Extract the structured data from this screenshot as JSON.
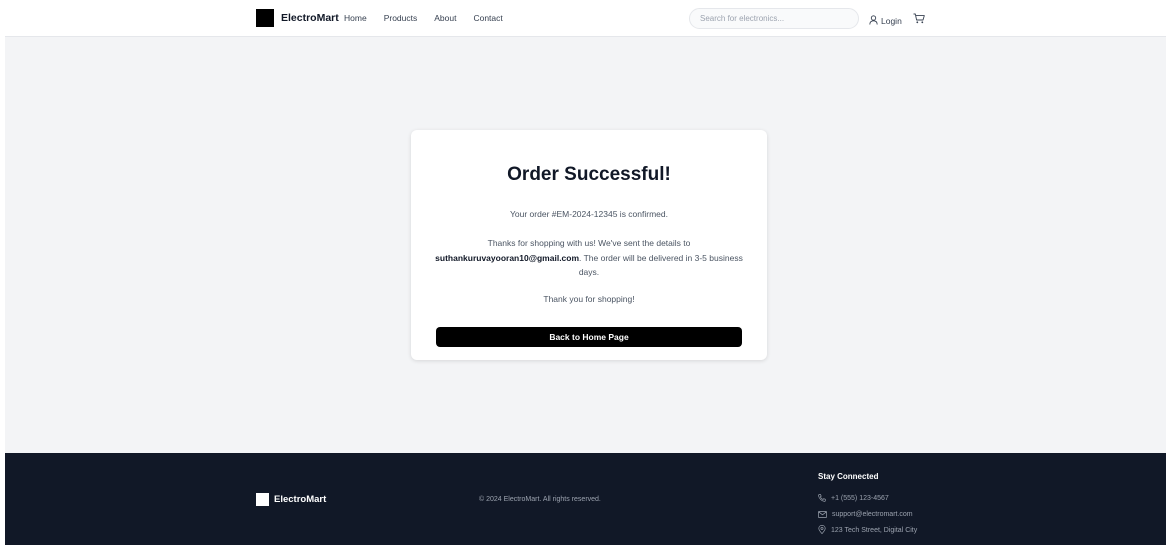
{
  "header": {
    "brand": "ElectroMart",
    "nav": [
      "Home",
      "Products",
      "About",
      "Contact"
    ],
    "search_placeholder": "Search for electronics...",
    "search_value": "",
    "login_label": "Login",
    "icons": {
      "login": "user-icon",
      "cart": "cart-icon"
    }
  },
  "card": {
    "title": "Order Successful!",
    "order_line": "Your order #EM-2024-12345 is confirmed.",
    "details_prefix": "Thanks for shopping with us! We've sent the details to",
    "email": "suthankuruvayooran10@gmail.com",
    "details_suffix": ". The order will be delivered in 3-5 business days.",
    "thanks": "Thank you for shopping!",
    "button_label": "Back to Home Page"
  },
  "footer": {
    "brand": "ElectroMart",
    "copyright": "© 2024 ElectroMart. All rights reserved.",
    "stay_title": "Stay Connected",
    "phone": "+1 (555) 123-4567",
    "email": "support@electromart.com",
    "address": "123 Tech Street, Digital City",
    "icons": {
      "phone": "phone-icon",
      "email": "mail-icon",
      "address": "map-pin-icon"
    }
  },
  "colors": {
    "background": "#f3f4f6",
    "footer_bg": "#111827",
    "button_bg": "#000000",
    "card_bg": "#ffffff"
  }
}
